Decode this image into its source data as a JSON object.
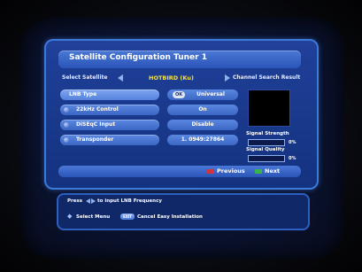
{
  "window": {
    "title": "Satellite Configuration Tuner 1"
  },
  "satellite_row": {
    "label": "Select Satellite",
    "value": "HOTBIRD (Ku)",
    "next_label": "Channel Search Result"
  },
  "settings": [
    {
      "label": "LNB Type",
      "value": "Universal",
      "ok_key": "OK"
    },
    {
      "label": "22kHz Control",
      "value": "On"
    },
    {
      "label": "DiSEqC Input",
      "value": "Disable"
    },
    {
      "label": "Transponder",
      "value": "1. 0949:27864"
    }
  ],
  "signal": {
    "strength_label": "Signal Strength",
    "strength_pct": "0%",
    "strength_value": 0,
    "quality_label": "Signal Quality",
    "quality_pct": "0%",
    "quality_value": 0
  },
  "footer": {
    "previous_label": "Previous",
    "next_label": "Next",
    "previous_color": "#d8333a",
    "next_color": "#39b54a"
  },
  "help": {
    "press_label": "Press",
    "lnb_hint": "to input LNB Frequency",
    "select_hint": "Select Menu",
    "exit_key": "EXIT",
    "cancel_hint": "Cancel Easy Installation"
  }
}
